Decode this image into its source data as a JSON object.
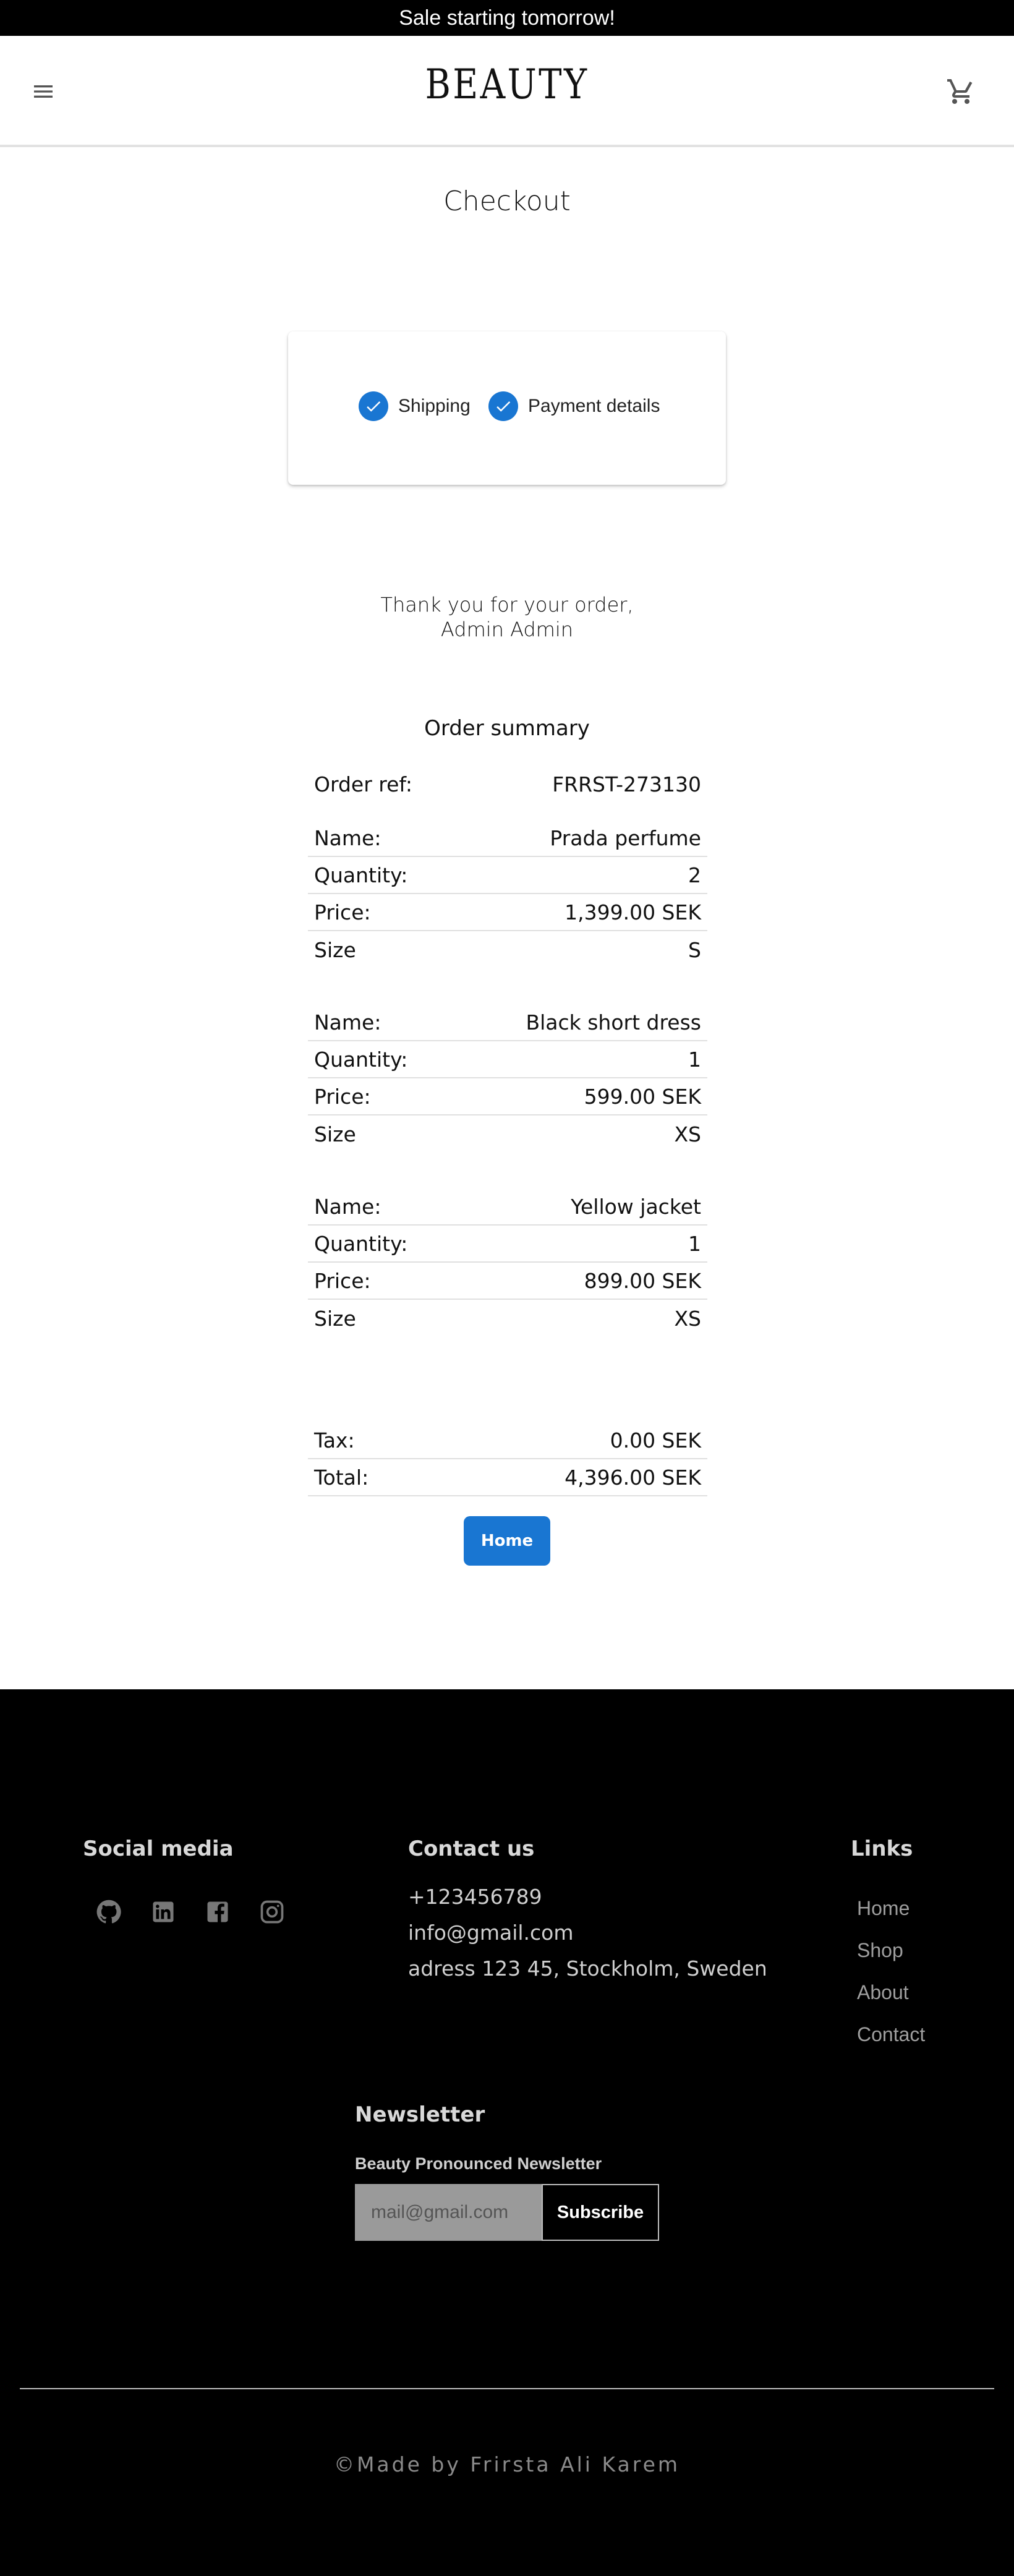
{
  "announcement": "Sale starting tomorrow!",
  "header": {
    "logo": "BEAUTY",
    "menu_icon": "hamburger-menu-icon",
    "cart_icon": "shopping-cart-icon"
  },
  "page_title": "Checkout",
  "stepper": {
    "accent": "#1976d2",
    "steps": [
      {
        "label": "Shipping",
        "status": "complete"
      },
      {
        "label": "Payment details",
        "status": "complete"
      }
    ]
  },
  "thanks": {
    "line1": "Thank you for your order,",
    "line2": "Admin Admin"
  },
  "summary": {
    "title": "Order summary",
    "order_ref_label": "Order ref:",
    "order_ref_value": "FRRST-273130",
    "items": [
      {
        "name_label": "Name:",
        "name": "Prada perfume",
        "quantity_label": "Quantity:",
        "quantity": "2",
        "price_label": "Price:",
        "price": "1,399.00 SEK",
        "size_label": "Size",
        "size": "S"
      },
      {
        "name_label": "Name:",
        "name": "Black short dress",
        "quantity_label": "Quantity:",
        "quantity": "1",
        "price_label": "Price:",
        "price": "599.00 SEK",
        "size_label": "Size",
        "size": "XS"
      },
      {
        "name_label": "Name:",
        "name": "Yellow jacket",
        "quantity_label": "Quantity:",
        "quantity": "1",
        "price_label": "Price:",
        "price": "899.00 SEK",
        "size_label": "Size",
        "size": "XS"
      }
    ],
    "tax_label": "Tax:",
    "tax": "0.00 SEK",
    "total_label": "Total:",
    "total": "4,396.00 SEK"
  },
  "home_button": "Home",
  "footer": {
    "social_heading": "Social media",
    "social_icons": [
      "github-icon",
      "linkedin-icon",
      "facebook-icon",
      "instagram-icon"
    ],
    "contact_heading": "Contact us",
    "phone": "+123456789",
    "email": "info@gmail.com",
    "address": "adress 123 45, Stockholm, Sweden",
    "links_heading": "Links",
    "links": [
      "Home",
      "Shop",
      "About",
      "Contact"
    ],
    "newsletter_heading": "Newsletter",
    "newsletter_subtitle": "Beauty Pronounced Newsletter",
    "newsletter_placeholder": "mail@gmail.com",
    "newsletter_button": "Subscribe",
    "copyright": "©Made by Frirsta Ali Karem"
  }
}
